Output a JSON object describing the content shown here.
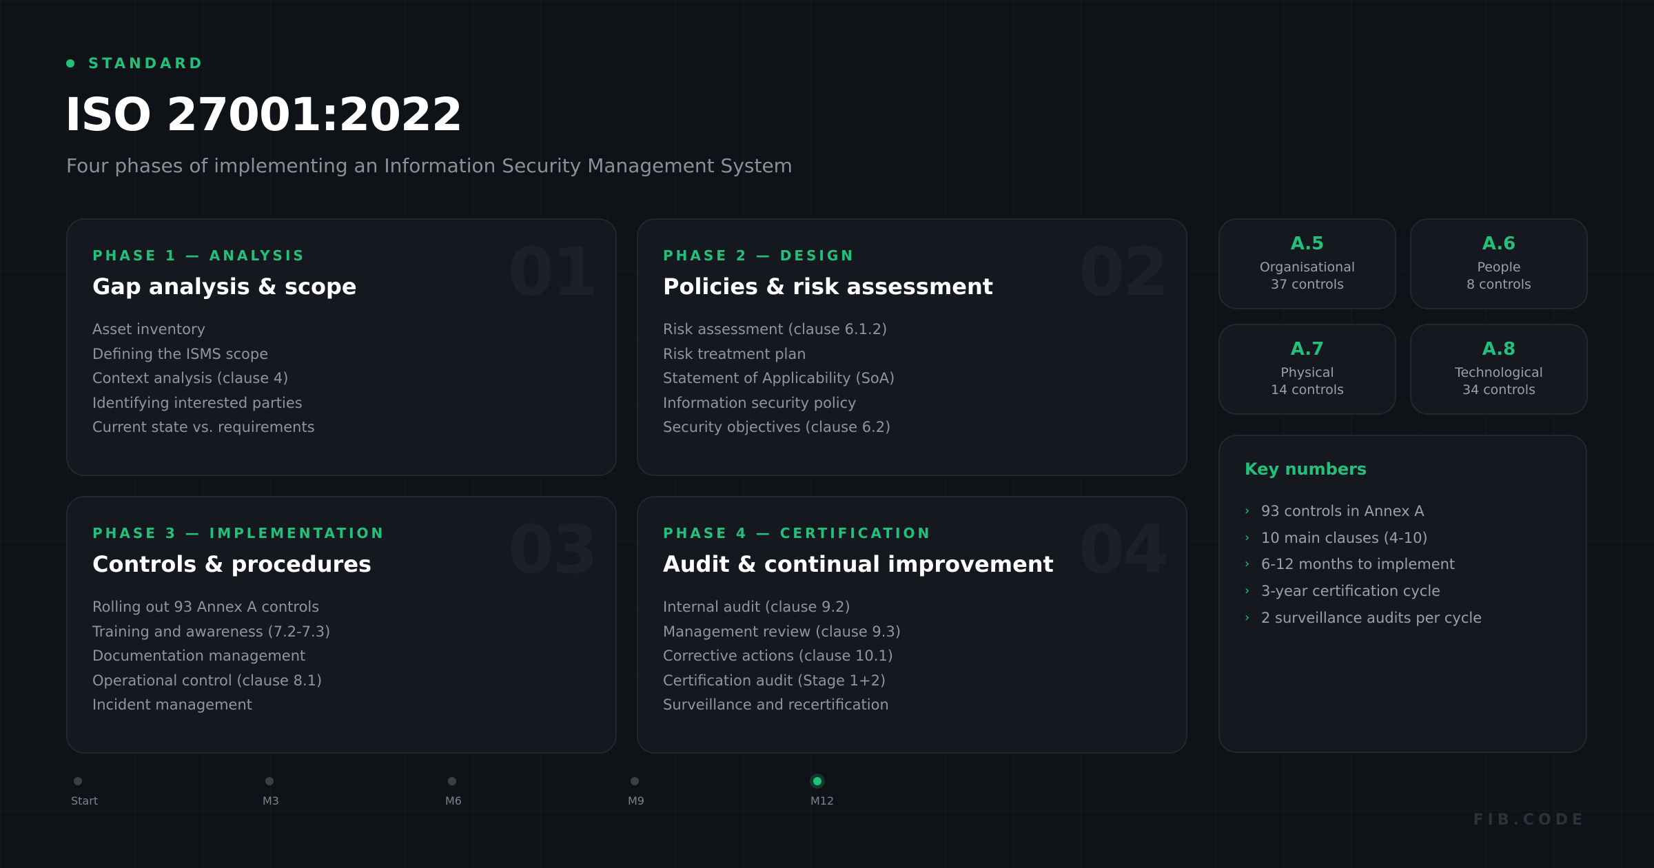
{
  "header": {
    "eyebrow": "STANDARD",
    "title": "ISO 27001:2022",
    "subtitle": "Four phases of implementing an Information Security Management System"
  },
  "phases": [
    {
      "number": "01",
      "label": "PHASE 1 — ANALYSIS",
      "title": "Gap analysis & scope",
      "items": [
        "Asset inventory",
        "Defining the ISMS scope",
        "Context analysis (clause 4)",
        "Identifying interested parties",
        "Current state vs. requirements"
      ]
    },
    {
      "number": "02",
      "label": "PHASE 2 — DESIGN",
      "title": "Policies & risk assessment",
      "items": [
        "Risk assessment (clause 6.1.2)",
        "Risk treatment plan",
        "Statement of Applicability (SoA)",
        "Information security policy",
        "Security objectives (clause 6.2)"
      ]
    },
    {
      "number": "03",
      "label": "PHASE 3 — IMPLEMENTATION",
      "title": "Controls & procedures",
      "items": [
        "Rolling out 93 Annex A controls",
        "Training and awareness (7.2-7.3)",
        "Documentation management",
        "Operational control (clause 8.1)",
        "Incident management"
      ]
    },
    {
      "number": "04",
      "label": "PHASE 4 — CERTIFICATION",
      "title": "Audit & continual improvement",
      "items": [
        "Internal audit (clause 9.2)",
        "Management review (clause 9.3)",
        "Corrective actions (clause 10.1)",
        "Certification audit (Stage 1+2)",
        "Surveillance and recertification"
      ]
    }
  ],
  "controls": [
    {
      "code": "A.5",
      "name": "Organisational",
      "count": "37 controls"
    },
    {
      "code": "A.6",
      "name": "People",
      "count": "8 controls"
    },
    {
      "code": "A.7",
      "name": "Physical",
      "count": "14 controls"
    },
    {
      "code": "A.8",
      "name": "Technological",
      "count": "34 controls"
    }
  ],
  "key_numbers": {
    "title": "Key numbers",
    "items": [
      "93 controls in Annex A",
      "10 main clauses (4-10)",
      "6-12 months to implement",
      "3-year certification cycle",
      "2 surveillance audits per cycle"
    ]
  },
  "timeline": {
    "ticks": [
      "Start",
      "M3",
      "M6",
      "M9",
      "M12"
    ],
    "active_tick": "M12"
  },
  "brand": "FIB.CODE",
  "colors": {
    "accent": "#22c07a",
    "background": "#0f1217",
    "card": "#15181f"
  },
  "icons": {
    "list_bullet": "chevron-right-icon"
  }
}
